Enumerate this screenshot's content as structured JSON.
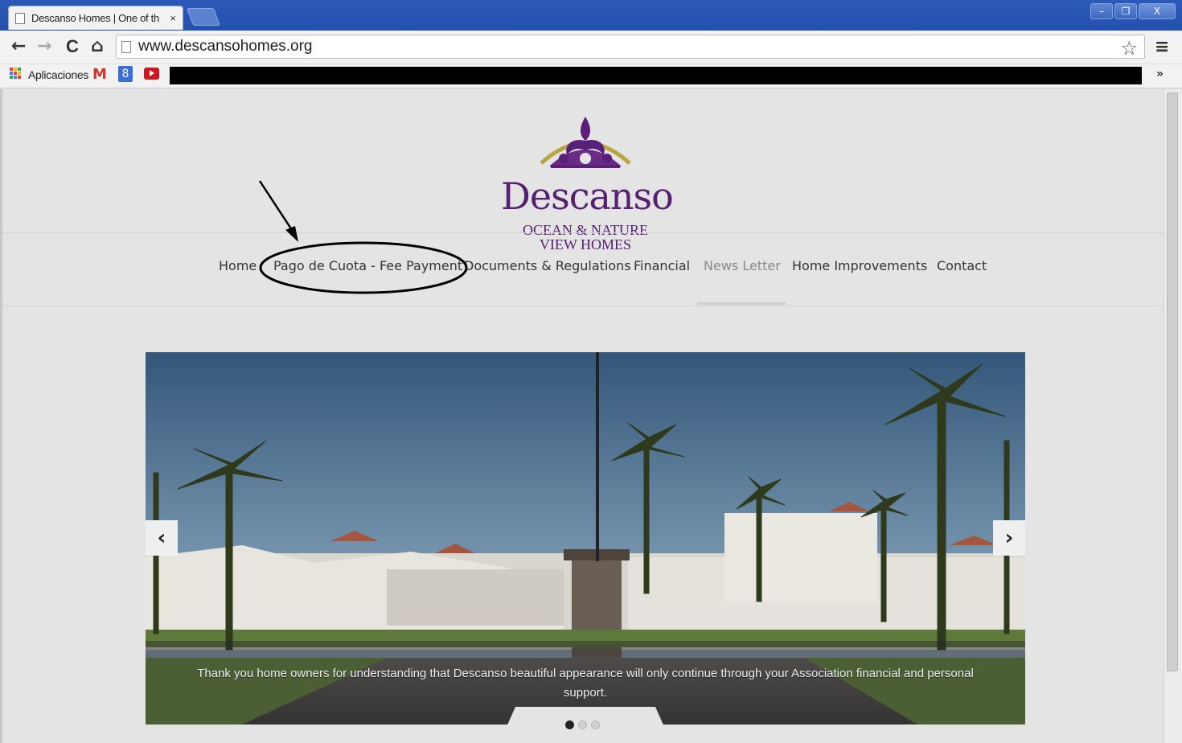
{
  "browser": {
    "tab_title": "Descanso Homes | One of th",
    "tab_close": "×",
    "url": "www.descansohomes.org",
    "window_controls": {
      "minimize": "–",
      "restore": "❐",
      "close": "X"
    },
    "nav_back": "←",
    "nav_forward": "→",
    "nav_reload": "C",
    "nav_home": "⌂",
    "star": "☆",
    "menu": "≡"
  },
  "bookmarks": {
    "apps_label": "Aplicaciones",
    "gmail": "M",
    "gplus": "8",
    "more": "»"
  },
  "logo": {
    "word": "Descanso",
    "line1": "OCEAN & NATURE",
    "line2": "VIEW HOMES",
    "color": "#55206f"
  },
  "nav": {
    "items": [
      {
        "label": "Home"
      },
      {
        "label": "Pago de Cuota - Fee Payment"
      },
      {
        "label": "Documents & Regulations"
      },
      {
        "label": "Financial"
      },
      {
        "label": "News Letter",
        "active": true
      },
      {
        "label": "Home Improvements"
      },
      {
        "label": "Contact"
      }
    ]
  },
  "slider": {
    "prev": "‹",
    "next": "›",
    "caption": "Thank you home owners for understanding that Descanso beautiful appearance will only continue through your Association financial and personal support.",
    "slide_count": 3,
    "active_slide": 1
  }
}
